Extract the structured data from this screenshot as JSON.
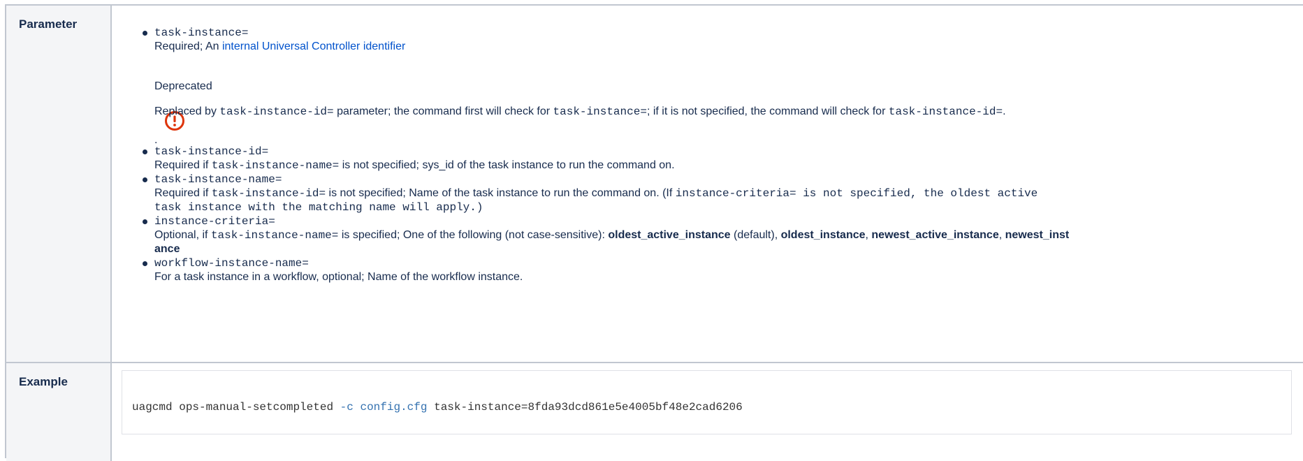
{
  "table": {
    "parameter_header": "Parameter",
    "example_header": "Example"
  },
  "parameters": {
    "task_instance": {
      "name": "task-instance=",
      "desc_prefix": "Required; An ",
      "desc_link": "internal Universal Controller identifier"
    },
    "deprecated": {
      "title": "Deprecated",
      "text_1": "Replaced by ",
      "code_1": "task-instance-id=",
      "text_2": " parameter; the command first will check for ",
      "code_2": "task-instance=",
      "text_3": "; if it is not specified, the command will check for ",
      "code_3": "task-instance-id=",
      "text_4": ".",
      "trailing_dot": "."
    },
    "task_instance_id": {
      "name": "task-instance-id=",
      "desc_prefix": "Required if ",
      "desc_code": "task-instance-name=",
      "desc_suffix": " is not specified; sys_id of the task instance to run the command on."
    },
    "task_instance_name": {
      "name": "task-instance-name=",
      "desc_prefix": "Required if ",
      "desc_code": "task-instance-id=",
      "desc_mid": " is not specified; Name of the task instance to run the command on. (If ",
      "desc_code2_line1": "instance-criteria= is not specified, the oldest active",
      "desc_code2_line2": "task instance with the matching name will apply.)"
    },
    "instance_criteria": {
      "name": "instance-criteria=",
      "desc_prefix": "Optional, if ",
      "desc_code": "task-instance-name=",
      "desc_mid": " is specified; One of the following (not case-sensitive): ",
      "opt1": "oldest_active_instance",
      "opt1_note": " (default), ",
      "opt2": "oldest_instance",
      "sep1": ", ",
      "opt3": "newest_active_instance",
      "sep2": ", ",
      "opt4_line1": "newest_inst",
      "opt4_line2": "ance"
    },
    "workflow_instance_name": {
      "name": "workflow-instance-name=",
      "desc": "For a task instance in a workflow, optional; Name of the workflow instance."
    }
  },
  "example": {
    "cmd": "uagcmd ops-manual-setcompleted ",
    "opt": "-c config.cfg",
    "rest": " task-instance=8fda93dcd861e5e4005bf48e2cad6206"
  },
  "colors": {
    "link": "#0052cc",
    "warning_icon": "#de350b",
    "border": "#c1c7d0",
    "header_bg": "#f4f5f7"
  },
  "icons": {
    "deprecated": "warning-icon"
  }
}
